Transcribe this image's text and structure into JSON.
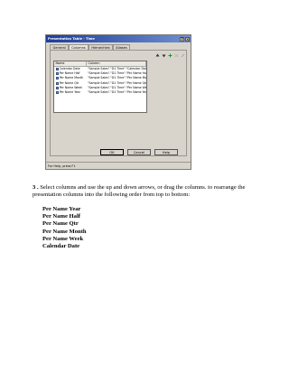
{
  "dialog": {
    "title": "Presentation Table - Time",
    "tabs": [
      "General",
      "Columns",
      "Hierarchies",
      "Aliases"
    ],
    "active_tab": "Columns",
    "columns_header": [
      "Name",
      "Column"
    ],
    "rows": [
      {
        "name": "Calendar Date",
        "column": "\"Sample Sales\".\"D1 Time\".\"Calendar Date\""
      },
      {
        "name": "Per Name Half",
        "column": "\"Sample Sales\".\"D1 Time\".\"Per Name Half\""
      },
      {
        "name": "Per Name Month",
        "column": "\"Sample Sales\".\"D1 Time\".\"Per Name Month\""
      },
      {
        "name": "Per Name Qtr",
        "column": "\"Sample Sales\".\"D1 Time\".\"Per Name Qtr\""
      },
      {
        "name": "Per Name Week",
        "column": "\"Sample Sales\".\"D1 Time\".\"Per Name Week\""
      },
      {
        "name": "Per Name Year",
        "column": "\"Sample Sales\".\"D1 Time\".\"Per Name Year\""
      }
    ],
    "buttons": {
      "ok": "OK",
      "cancel": "Cancel",
      "help": "Help"
    },
    "status": "For Help, press F1",
    "toolbar_icons": [
      "move-up-icon",
      "move-down-icon",
      "add-icon",
      "delete-icon",
      "edit-icon"
    ],
    "colors": {
      "titlebar": "#1d3e9a",
      "dialog_bg": "#d8d4cc",
      "add": "#1a9a2a",
      "delete": "#b8b8b8"
    }
  },
  "instruction": {
    "number": "3 .",
    "text": "Select columns and use the up and down arrows, or drag the columns. to rearrange the presentation columns into the following order from top to bottom:"
  },
  "order": [
    "Per Name Year",
    "Per Name Half",
    "Per Name Qtr",
    "Per Name Month",
    "Per Name Week",
    "Calendar Date"
  ]
}
